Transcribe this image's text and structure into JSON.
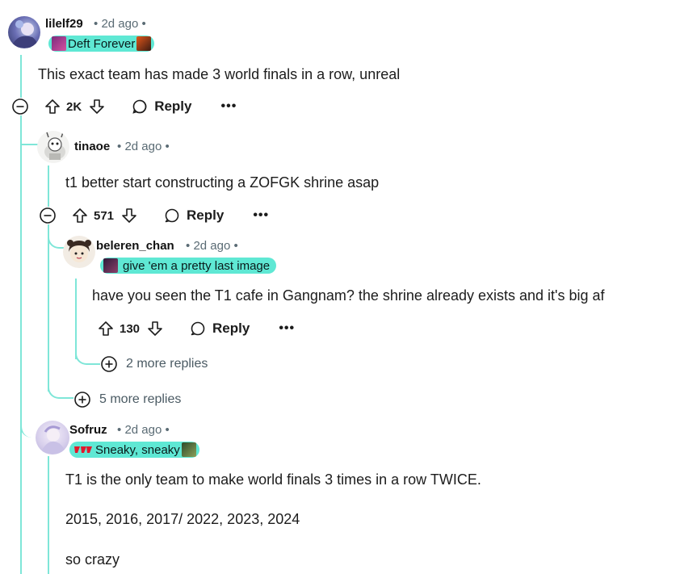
{
  "comments": [
    {
      "username": "lilelf29",
      "time": "2d ago",
      "flair": "Deft Forever",
      "body": "This exact team has made 3 world finals in a row, unreal",
      "score": "2K",
      "reply_label": "Reply",
      "more_label": "•••"
    },
    {
      "username": "tinaoe",
      "time": "2d ago",
      "body": "t1 better start constructing a ZOFGK shrine asap",
      "score": "571",
      "reply_label": "Reply",
      "more_label": "•••"
    },
    {
      "username": "beleren_chan",
      "time": "2d ago",
      "flair": "give 'em a pretty last image",
      "body": "have you seen the T1 cafe in Gangnam? the shrine already exists and it's big af",
      "score": "130",
      "reply_label": "Reply",
      "more_label": "•••"
    },
    {
      "username": "Sofruz",
      "time": "2d ago",
      "flair": "Sneaky, sneaky",
      "body_lines": [
        "T1 is the only team to make world finals 3 times in a row TWICE.",
        "2015, 2016, 2017/ 2022, 2023, 2024",
        "so crazy"
      ]
    }
  ],
  "more_replies": [
    "2 more replies",
    "5 more replies"
  ],
  "meta_separator": "•",
  "colors": {
    "thread_line": "#7fe6d8",
    "flair_bg": "#5fe8d4"
  },
  "icons": [
    "collapse-icon",
    "upvote-icon",
    "downvote-icon",
    "comment-icon",
    "plus-circle-icon"
  ]
}
